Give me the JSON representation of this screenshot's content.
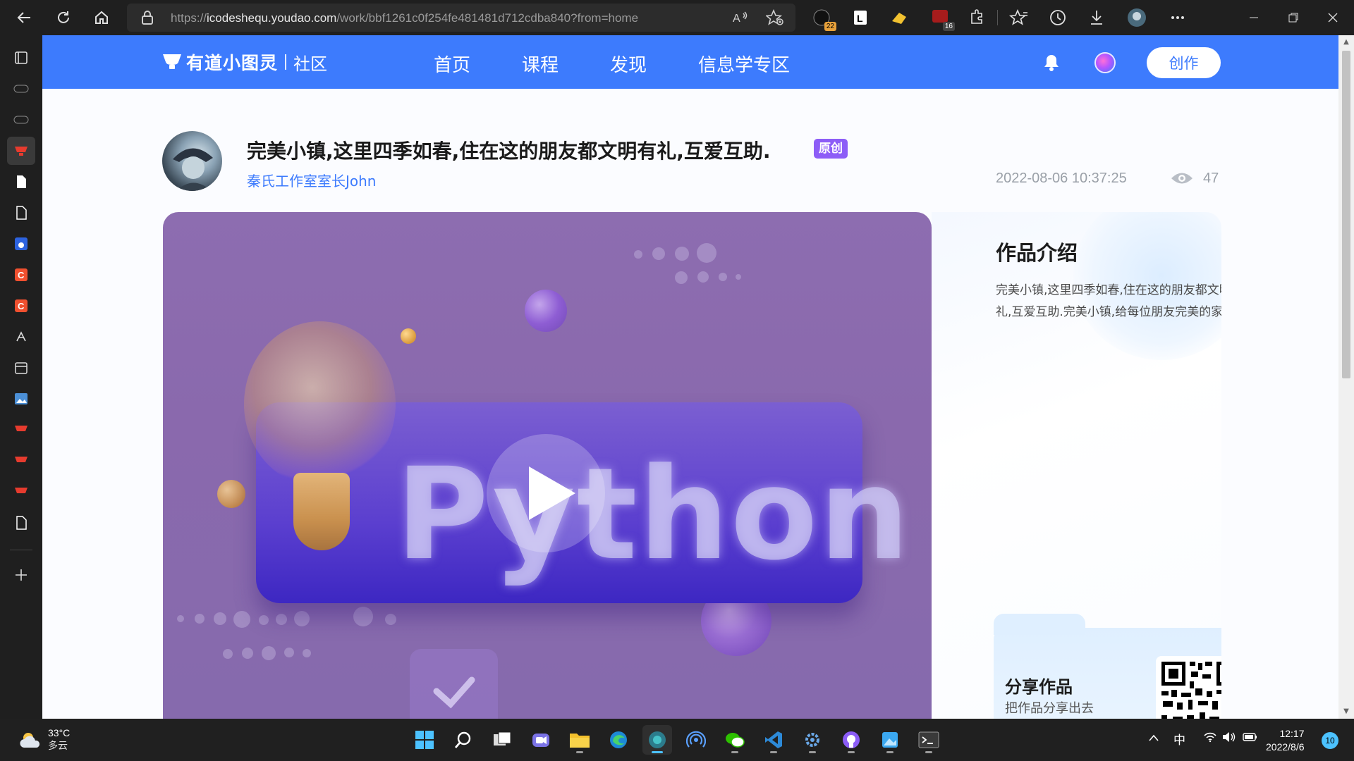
{
  "browser": {
    "url_prefix": "https://",
    "url_host": "icodeshequ.youdao.com",
    "url_path": "/work/bbf1261c0f254fe481481d712cdba840?from=home",
    "extensions": [
      {
        "name": "ext-1",
        "badge": "22"
      },
      {
        "name": "ext-2",
        "badge": ""
      },
      {
        "name": "ext-3",
        "badge": ""
      },
      {
        "name": "ext-4",
        "badge": "16"
      }
    ]
  },
  "site": {
    "logo_name": "有道小图灵",
    "logo_sub": "社区",
    "nav": [
      "首页",
      "课程",
      "发现",
      "信息学专区"
    ],
    "create_label": "创作",
    "accent": "#3d7bfd"
  },
  "work": {
    "title": "完美小镇,这里四季如春,住在这的朋友都文明有礼,互爱互助.",
    "tag": "原创",
    "author": "秦氏工作室室长John",
    "date": "2022-08-06 10:37:25",
    "views": "47",
    "media_text": "Python"
  },
  "intro": {
    "title": "作品介绍",
    "desc": "完美小镇,这里四季如春,住在这的朋友都文明有礼,互爱互助.完美小镇,给每位朋友完美的家!"
  },
  "share": {
    "title": "分享作品",
    "sub": "把作品分享出去"
  },
  "taskbar": {
    "temp": "33°C",
    "weather": "多云",
    "ime": "中",
    "time": "12:17",
    "date": "2022/8/6",
    "notifications": "10"
  }
}
